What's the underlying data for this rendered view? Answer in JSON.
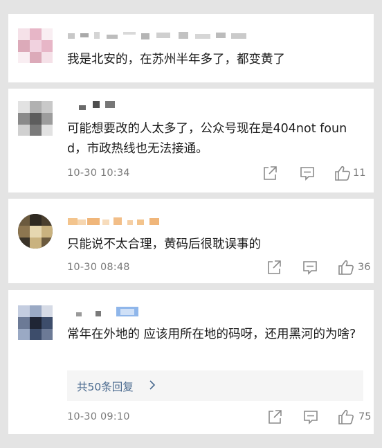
{
  "comments": [
    {
      "text": "我是北安的，在苏州半年多了，都变黄了",
      "avatar_colors": [
        "#f1d2df",
        "#e7b6c7",
        "#f9eef2",
        "#dcaab9",
        "#f5e1e8"
      ],
      "name_color": "#b9b9b9"
    },
    {
      "text": "可能想要改的人太多了，公众号现在是404not found，市政热线也无法接通。",
      "timestamp": "10-30 10:34",
      "likes": "11",
      "avatar_colors": [
        "#c9c9c9",
        "#8a8a8a",
        "#e2e2e2",
        "#5d5d5d",
        "#b1b1b1"
      ],
      "name_color": "#666666"
    },
    {
      "text": "只能说不太合理，黄码后很耽误事的",
      "timestamp": "10-30 08:48",
      "likes": "36",
      "avatar_colors": [
        "#6b5a3e",
        "#2f2a22",
        "#c9b27f",
        "#8d7650",
        "#e6d7b0"
      ],
      "name_color": "#f3c48d"
    },
    {
      "text": "常年在外地的 应该用所在地的码呀，还用黑河的为啥?",
      "timestamp": "10-30 09:10",
      "likes": "75",
      "replies": "共50条回复",
      "avatar_colors": [
        "#3d4d6b",
        "#9aa9c4",
        "#1f2535",
        "#6c7a96",
        "#c4cde0"
      ],
      "name_color": "#8fb6ea"
    }
  ],
  "icons": {
    "share": "share-icon",
    "comment": "comment-icon",
    "like": "thumbs-up-icon"
  },
  "colors": {
    "page_background": "#e4e4e4",
    "card_background": "#ffffff",
    "meta_text": "#7a7a7a",
    "replies_link": "#4a6a8f"
  }
}
